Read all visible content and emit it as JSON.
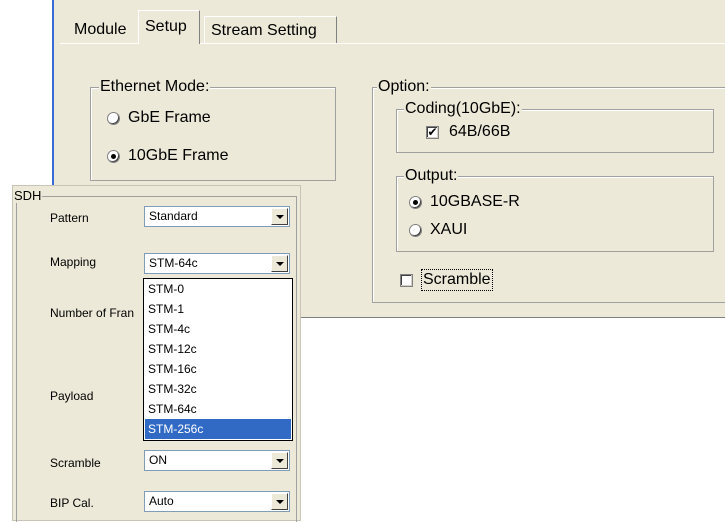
{
  "tabs": [
    {
      "label": "Module",
      "selected": false
    },
    {
      "label": "Setup",
      "selected": true
    },
    {
      "label": "Stream Setting",
      "selected": false
    }
  ],
  "ethernet_mode": {
    "legend": "Ethernet Mode:",
    "options": [
      {
        "label": "GbE Frame",
        "selected": false
      },
      {
        "label": "10GbE Frame",
        "selected": true
      }
    ]
  },
  "option": {
    "legend": "Option:",
    "coding": {
      "legend": "Coding(10GbE):",
      "checkbox_label": "64B/66B",
      "checked": true
    },
    "output": {
      "legend": "Output:",
      "options": [
        {
          "label": "10GBASE-R",
          "selected": true
        },
        {
          "label": "XAUI",
          "selected": false
        }
      ]
    },
    "scramble": {
      "label": "Scramble",
      "checked": false
    }
  },
  "sdh": {
    "title": "SDH",
    "pattern": {
      "label": "Pattern",
      "value": "Standard"
    },
    "mapping": {
      "label": "Mapping",
      "value": "STM-64c"
    },
    "number_of_frames": {
      "label": "Number of Fran"
    },
    "payload": {
      "label": "Payload"
    },
    "scramble": {
      "label": "Scramble",
      "value": "ON"
    },
    "bip_cal": {
      "label": "BIP Cal.",
      "value": "Auto"
    },
    "mapping_options": [
      "STM-0",
      "STM-1",
      "STM-4c",
      "STM-12c",
      "STM-16c",
      "STM-32c",
      "STM-64c",
      "STM-256c"
    ],
    "highlighted_option": "STM-256c"
  },
  "colors": {
    "highlight": "#316ac5",
    "dialog": "#ece9d8",
    "accent_border": "#3b6bd6"
  }
}
